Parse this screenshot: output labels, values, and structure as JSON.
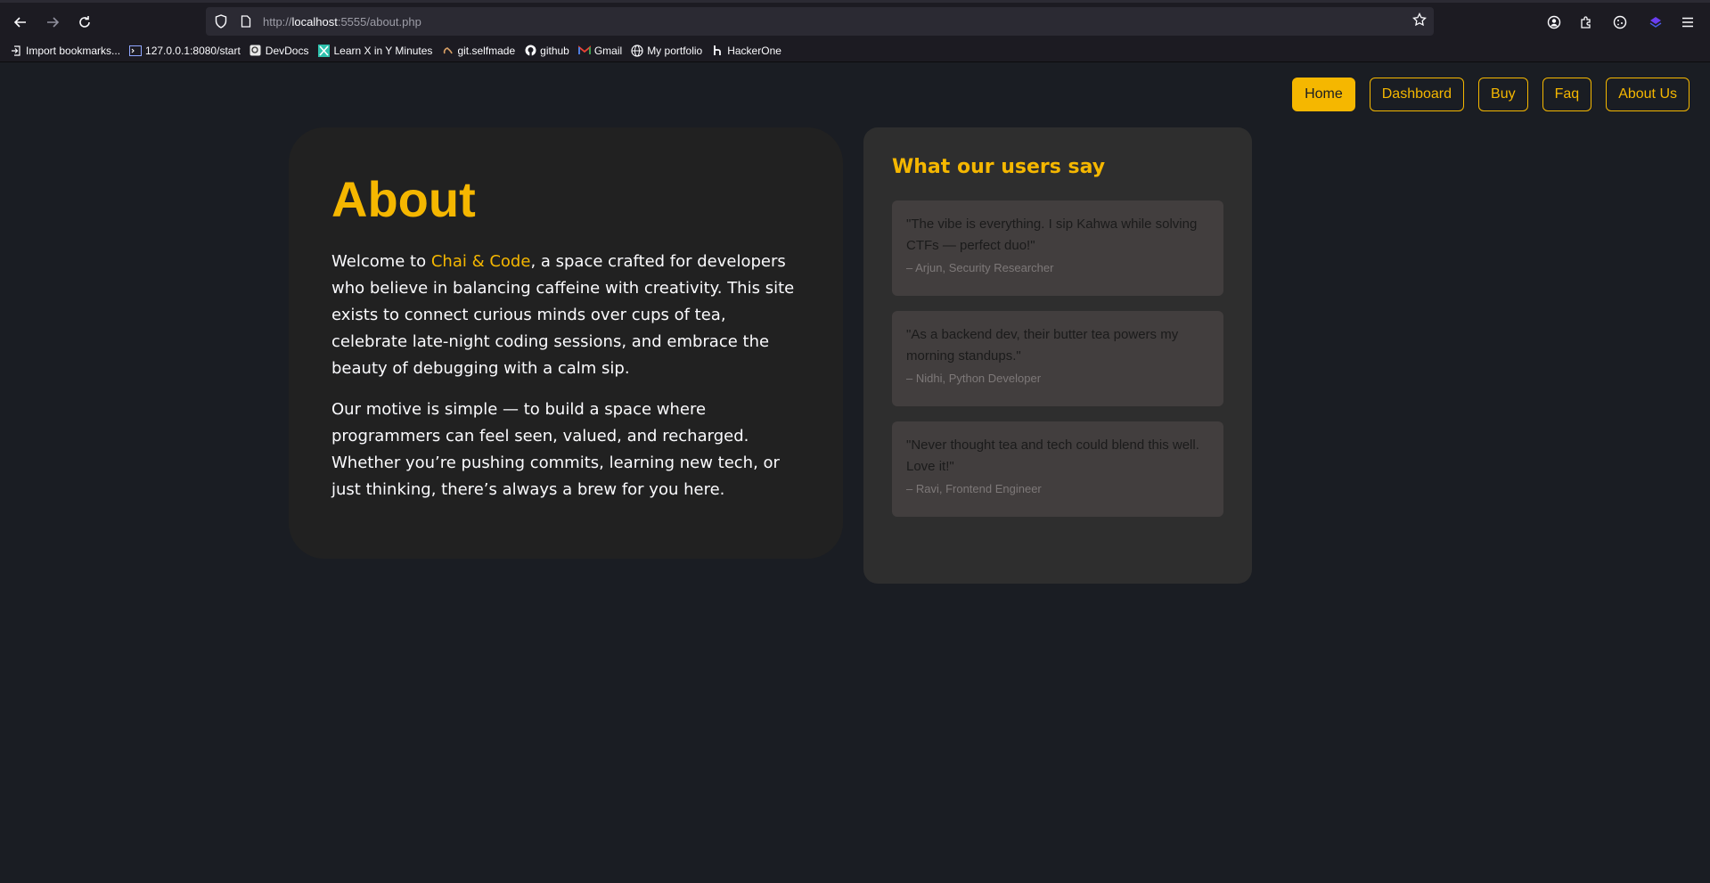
{
  "browser": {
    "url_prefix": "http://",
    "url_host": "localhost",
    "url_rest": ":5555/about.php",
    "bookmarks": [
      {
        "label": "Import bookmarks...",
        "icon": "import-icon"
      },
      {
        "label": "127.0.0.1:8080/start",
        "icon": "terminal-icon"
      },
      {
        "label": "DevDocs",
        "icon": "devdocs-icon"
      },
      {
        "label": "Learn X in Y Minutes",
        "icon": "learnx-icon"
      },
      {
        "label": "git.selfmade",
        "icon": "git-icon"
      },
      {
        "label": "github",
        "icon": "github-icon"
      },
      {
        "label": "Gmail",
        "icon": "gmail-icon"
      },
      {
        "label": "My portfolio",
        "icon": "globe-icon"
      },
      {
        "label": "HackerOne",
        "icon": "hackerone-icon"
      }
    ]
  },
  "nav": {
    "home": "Home",
    "dashboard": "Dashboard",
    "buy": "Buy",
    "faq": "Faq",
    "about": "About Us"
  },
  "about": {
    "title": "About",
    "p1_prefix": "Welcome to ",
    "brand": "Chai & Code",
    "p1_suffix": ", a space crafted for developers who believe in balancing caffeine with creativity. This site exists to connect curious minds over cups of tea, celebrate late-night coding sessions, and embrace the beauty of debugging with a calm sip.",
    "p2": "Our motive is simple — to build a space where programmers can feel seen, valued, and recharged. Whether you’re pushing commits, learning new tech, or just thinking, there’s always a brew for you here."
  },
  "testimonials": {
    "title": "What our users say",
    "items": [
      {
        "quote": "\"The vibe is everything. I sip Kahwa while solving CTFs — perfect duo!\"",
        "author": "– Arjun, Security Researcher"
      },
      {
        "quote": "\"As a backend dev, their butter tea powers my morning standups.\"",
        "author": "– Nidhi, Python Developer"
      },
      {
        "quote": "\"Never thought tea and tech could blend this well. Love it!\"",
        "author": "– Ravi, Frontend Engineer"
      }
    ]
  },
  "colors": {
    "accent": "#f5b700",
    "background": "#1a1d23",
    "card": "#212121",
    "testimonial_card": "#2e2e2e",
    "quote_box": "#423e3e"
  }
}
